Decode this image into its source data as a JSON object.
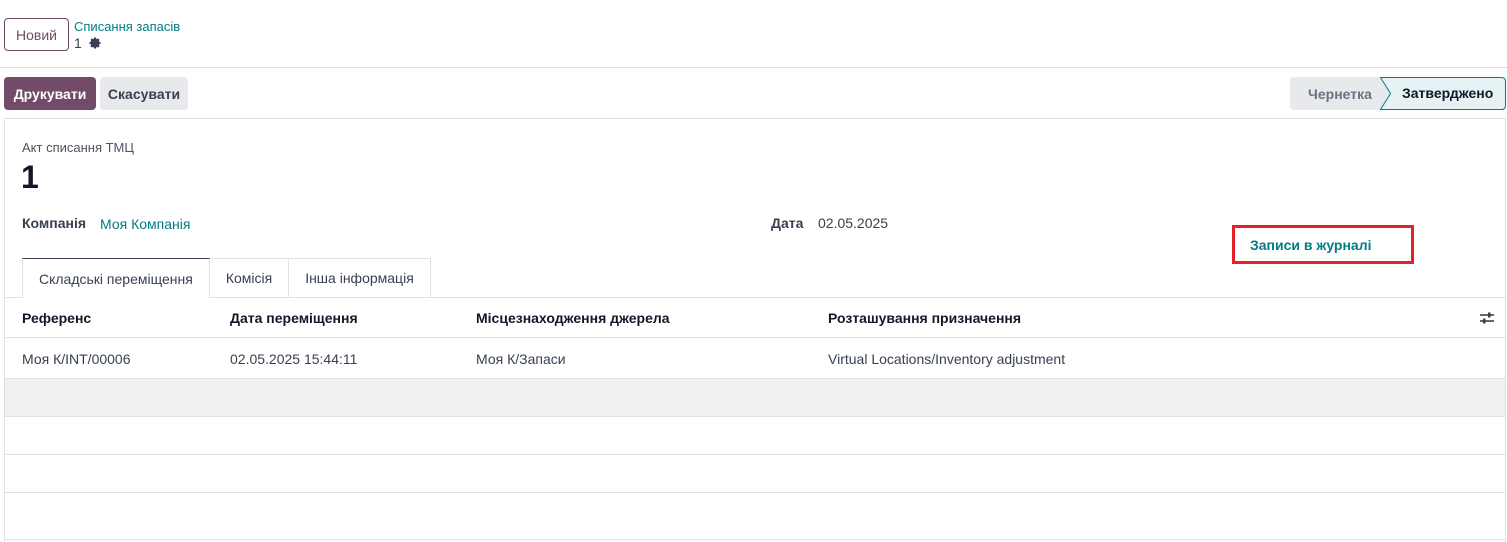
{
  "control_panel": {
    "new_button": "Новий",
    "breadcrumb": "Списання запасів",
    "record": "1",
    "settings_icon": "gear-icon"
  },
  "status_bar": {
    "print_button": "Друкувати",
    "cancel_button": "Скасувати",
    "stages": [
      "Чернетка",
      "Затверджено"
    ],
    "current_stage": "Затверджено"
  },
  "form": {
    "doc_label": "Акт списання ТМЦ",
    "doc_name": "1",
    "company_label": "Компанія",
    "company_value": "Моя Компанія",
    "date_label": "Дата",
    "date_value": "02.05.2025"
  },
  "tabs": [
    {
      "label": "Складські переміщення",
      "active": true
    },
    {
      "label": "Комісія",
      "active": false
    },
    {
      "label": "Інша інформація",
      "active": false
    }
  ],
  "table": {
    "columns": [
      "Референс",
      "Дата переміщення",
      "Місцезнаходження джерела",
      "Розташування призначення"
    ],
    "rows": [
      {
        "reference": "Моя К/INT/00006",
        "date": "02.05.2025 15:44:11",
        "source": "Моя К/Запаси",
        "destination": "Virtual Locations/Inventory adjustment",
        "action": "Записи в журналі"
      }
    ]
  },
  "colors": {
    "primary": "#714b67",
    "link": "#017e84",
    "highlight": "#e5202b"
  }
}
